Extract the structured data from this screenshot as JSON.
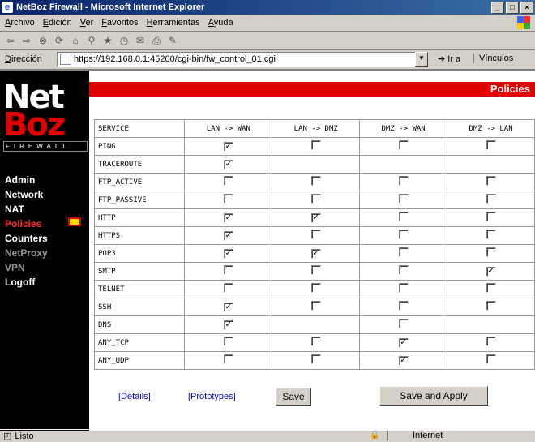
{
  "window": {
    "title": "NetBoz Firewall - Microsoft Internet Explorer"
  },
  "menu": [
    "Archivo",
    "Edición",
    "Ver",
    "Favoritos",
    "Herramientas",
    "Ayuda"
  ],
  "address": {
    "label": "Dirección",
    "url": "https://192.168.0.1:45200/cgi-bin/fw_control_01.cgi",
    "go": "Ir a",
    "links": "Vínculos"
  },
  "logo": {
    "line1": "Net",
    "line2": "Boz",
    "line3": "FIREWALL"
  },
  "nav": [
    "Admin",
    "Network",
    "NAT",
    "Policies",
    "Counters",
    "NetProxy",
    "VPN",
    "Logoff"
  ],
  "page": {
    "title": "Policies"
  },
  "table": {
    "headers": [
      "SERVICE",
      "LAN -> WAN",
      "LAN -> DMZ",
      "DMZ -> WAN",
      "DMZ -> LAN"
    ],
    "rows": [
      {
        "service": "PING",
        "checks": [
          true,
          false,
          false,
          false
        ]
      },
      {
        "service": "TRACEROUTE",
        "checks": [
          true,
          null,
          null,
          null
        ]
      },
      {
        "service": "FTP_ACTIVE",
        "checks": [
          false,
          false,
          false,
          false
        ]
      },
      {
        "service": "FTP_PASSIVE",
        "checks": [
          false,
          false,
          false,
          false
        ]
      },
      {
        "service": "HTTP",
        "checks": [
          true,
          true,
          false,
          false
        ]
      },
      {
        "service": "HTTPS",
        "checks": [
          true,
          false,
          false,
          false
        ]
      },
      {
        "service": "POP3",
        "checks": [
          true,
          true,
          false,
          false
        ]
      },
      {
        "service": "SMTP",
        "checks": [
          false,
          false,
          false,
          true
        ]
      },
      {
        "service": "TELNET",
        "checks": [
          false,
          false,
          false,
          false
        ]
      },
      {
        "service": "SSH",
        "checks": [
          true,
          false,
          false,
          false
        ]
      },
      {
        "service": "DNS",
        "checks": [
          true,
          null,
          false,
          null
        ]
      },
      {
        "service": "ANY_TCP",
        "checks": [
          false,
          false,
          true,
          false
        ]
      },
      {
        "service": "ANY_UDP",
        "checks": [
          false,
          false,
          true,
          false
        ]
      }
    ]
  },
  "actions": {
    "details": "[Details]",
    "prototypes": "[Prototypes]",
    "save": "Save",
    "save_apply": "Save and Apply"
  },
  "status": {
    "text": "Listo",
    "zone": "Internet"
  }
}
